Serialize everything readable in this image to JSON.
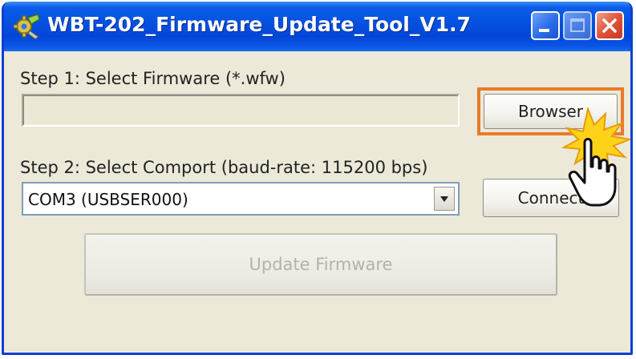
{
  "window": {
    "title": "WBT-202_Firmware_Update_Tool_V1.7",
    "app_icon": "gear-wrench-icon",
    "controls": {
      "minimize_icon": "minimize-icon",
      "maximize_icon": "maximize-icon",
      "close_icon": "close-icon"
    }
  },
  "step1": {
    "label": "Step 1: Select Firmware (*.wfw)",
    "file_value": "",
    "browse_button": "Browser"
  },
  "step2": {
    "label": "Step 2: Select Comport (baud-rate: 115200 bps)",
    "comport_selected": "COM3 (USBSER000)",
    "connect_button": "Connect"
  },
  "update_button": {
    "label": "Update Firmware",
    "enabled": false
  },
  "annotation": {
    "cursor_icon": "hand-pointer-icon",
    "click_burst_icon": "click-burst-icon",
    "highlight_color": "#e87a2c"
  },
  "colors": {
    "titlebar": "#0550e0",
    "window_bg": "#ece9d8",
    "disabled_text": "#b4b2a8"
  }
}
